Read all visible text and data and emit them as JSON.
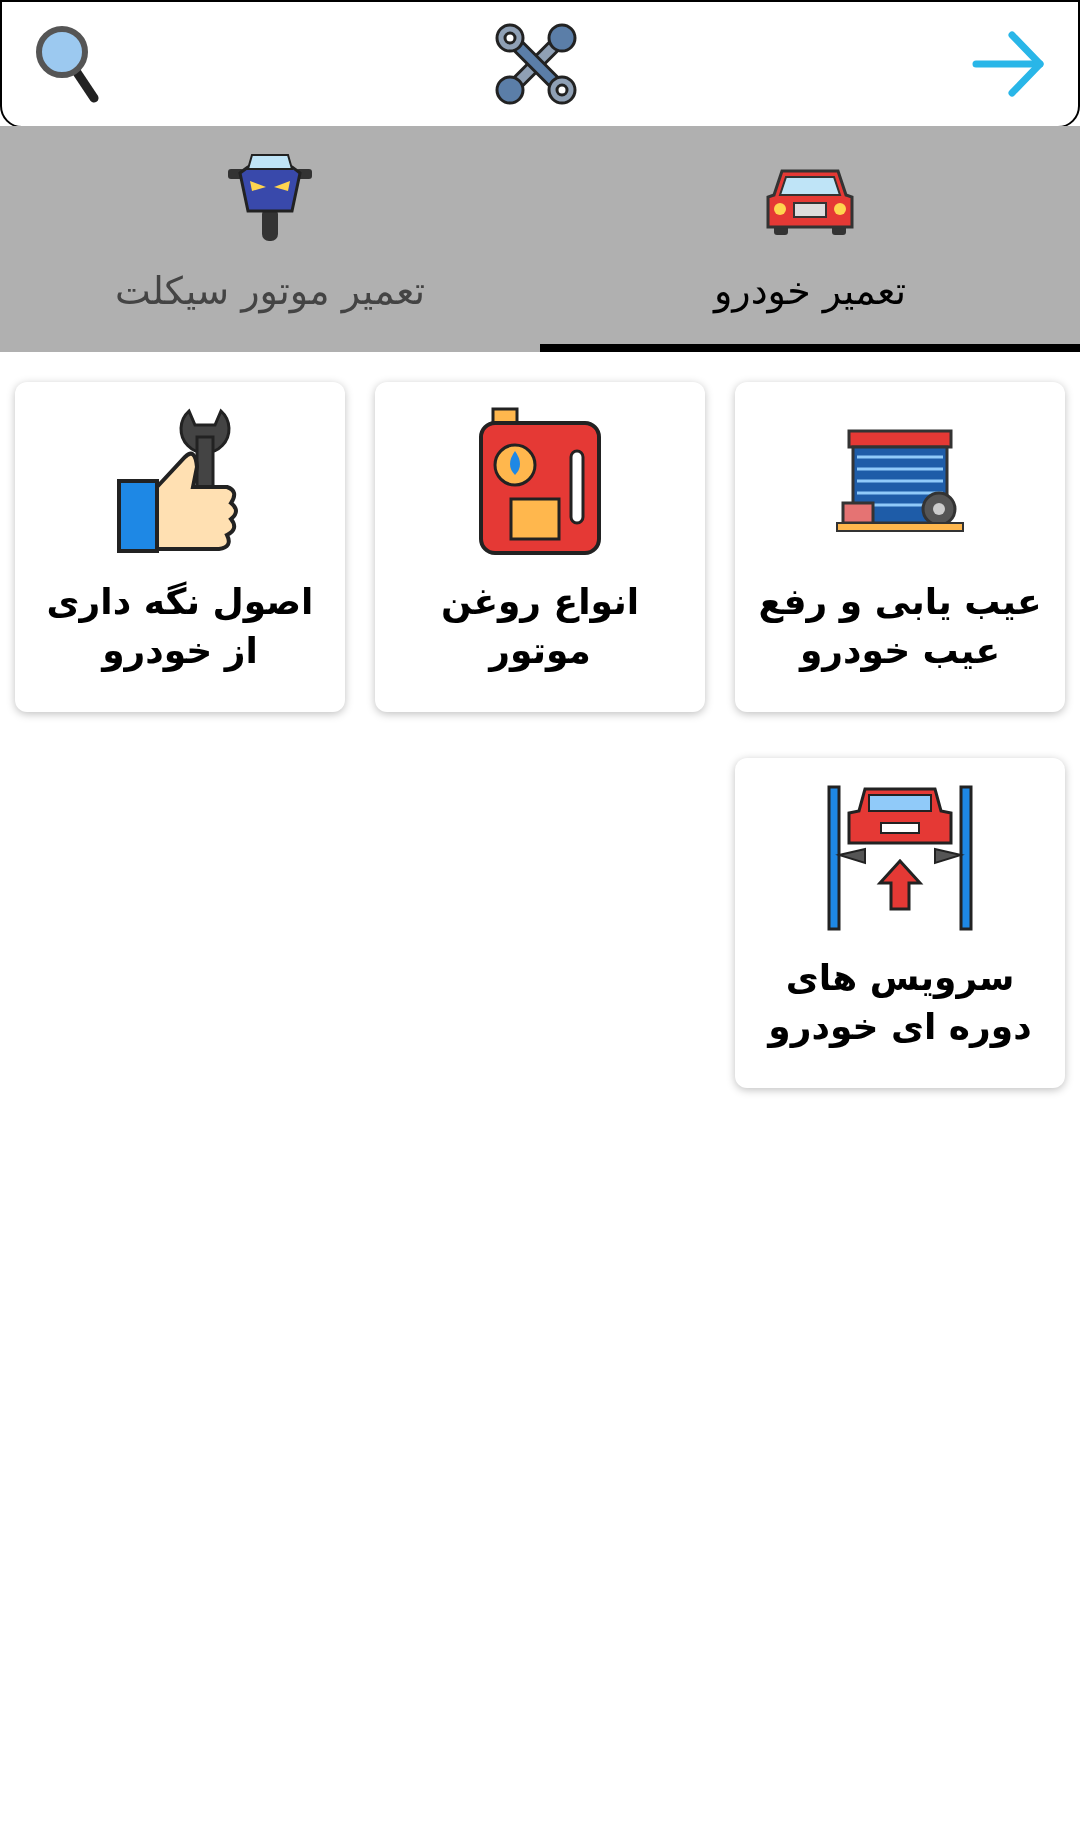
{
  "tabs": [
    {
      "label": "تعمیر خودرو",
      "kind": "car",
      "selected": true
    },
    {
      "label": "تعمیر موتور سیکلت",
      "kind": "motorcycle",
      "selected": false
    }
  ],
  "cards": [
    {
      "title": "عیب یابی و رفع عیب خودرو",
      "kind": "garage"
    },
    {
      "title": "انواع روغن موتور",
      "kind": "oil"
    },
    {
      "title": "اصول نگه داری از خودرو",
      "kind": "thumb"
    },
    {
      "title": "سرویس های دوره ای خودرو",
      "kind": "lift"
    }
  ]
}
